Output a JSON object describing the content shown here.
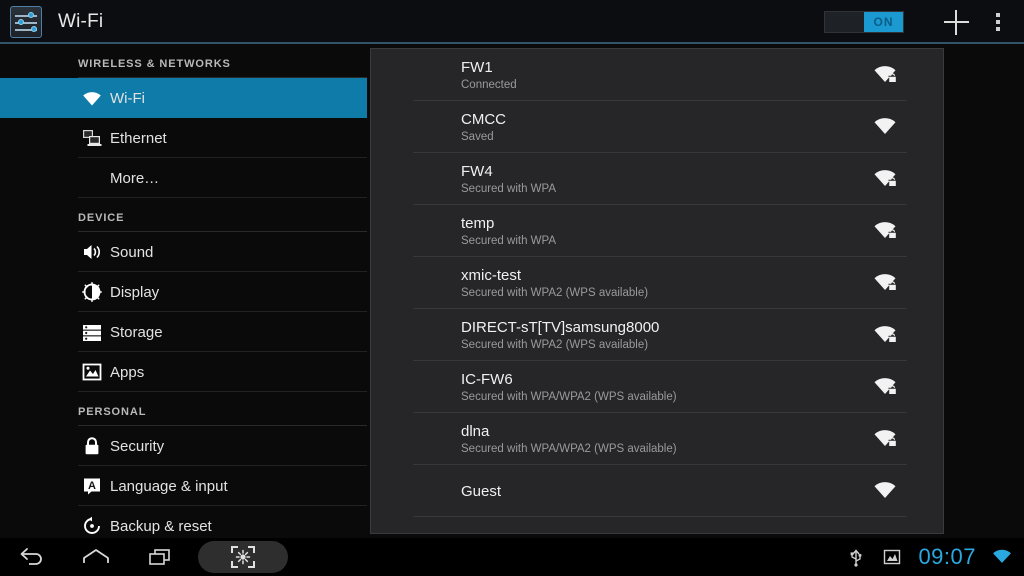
{
  "actionbar": {
    "app_icon": "settings-sliders-icon",
    "title": "Wi-Fi",
    "toggle": {
      "state_label": "ON",
      "accent": "#1a9ad1"
    },
    "add_network_icon": "plus-icon",
    "overflow_icon": "overflow-menu-icon"
  },
  "sidebar": {
    "sections": [
      {
        "header": "WIRELESS & NETWORKS",
        "items": [
          {
            "label": "Wi-Fi",
            "icon": "wifi-icon",
            "selected": true
          },
          {
            "label": "Ethernet",
            "icon": "ethernet-icon",
            "selected": false
          },
          {
            "label": "More…",
            "icon": "",
            "selected": false
          }
        ]
      },
      {
        "header": "DEVICE",
        "items": [
          {
            "label": "Sound",
            "icon": "sound-icon",
            "selected": false
          },
          {
            "label": "Display",
            "icon": "display-icon",
            "selected": false
          },
          {
            "label": "Storage",
            "icon": "storage-icon",
            "selected": false
          },
          {
            "label": "Apps",
            "icon": "apps-icon",
            "selected": false
          }
        ]
      },
      {
        "header": "PERSONAL",
        "items": [
          {
            "label": "Security",
            "icon": "lock-icon",
            "selected": false
          },
          {
            "label": "Language & input",
            "icon": "language-icon",
            "selected": false
          },
          {
            "label": "Backup & reset",
            "icon": "backup-reset-icon",
            "selected": false
          }
        ]
      }
    ],
    "selected_accent": "#0f7ba8"
  },
  "networks": [
    {
      "ssid": "FW1",
      "status": "Connected",
      "secured": true,
      "signal": 4
    },
    {
      "ssid": "CMCC",
      "status": "Saved",
      "secured": false,
      "signal": 3
    },
    {
      "ssid": "FW4",
      "status": "Secured with WPA",
      "secured": true,
      "signal": 4
    },
    {
      "ssid": "temp",
      "status": "Secured with WPA",
      "secured": true,
      "signal": 4
    },
    {
      "ssid": "xmic-test",
      "status": "Secured with WPA2 (WPS available)",
      "secured": true,
      "signal": 4
    },
    {
      "ssid": "DIRECT-sT[TV]samsung8000",
      "status": "Secured with WPA2 (WPS available)",
      "secured": true,
      "signal": 3
    },
    {
      "ssid": "IC-FW6",
      "status": "Secured with WPA/WPA2 (WPS available)",
      "secured": true,
      "signal": 4
    },
    {
      "ssid": "dlna",
      "status": "Secured with WPA/WPA2 (WPS available)",
      "secured": true,
      "signal": 4
    },
    {
      "ssid": "Guest",
      "status": "",
      "secured": false,
      "signal": 3
    }
  ],
  "navbar": {
    "back_icon": "back-arrow-icon",
    "home_icon": "home-icon",
    "recents_icon": "recent-apps-icon",
    "screenshot_icon": "screenshot-icon",
    "usb_icon": "usb-icon",
    "image_icon": "screenshot-captured-icon",
    "clock": "09:07",
    "wifi_icon": "wifi-status-icon",
    "clock_color": "#2aa9e0"
  }
}
